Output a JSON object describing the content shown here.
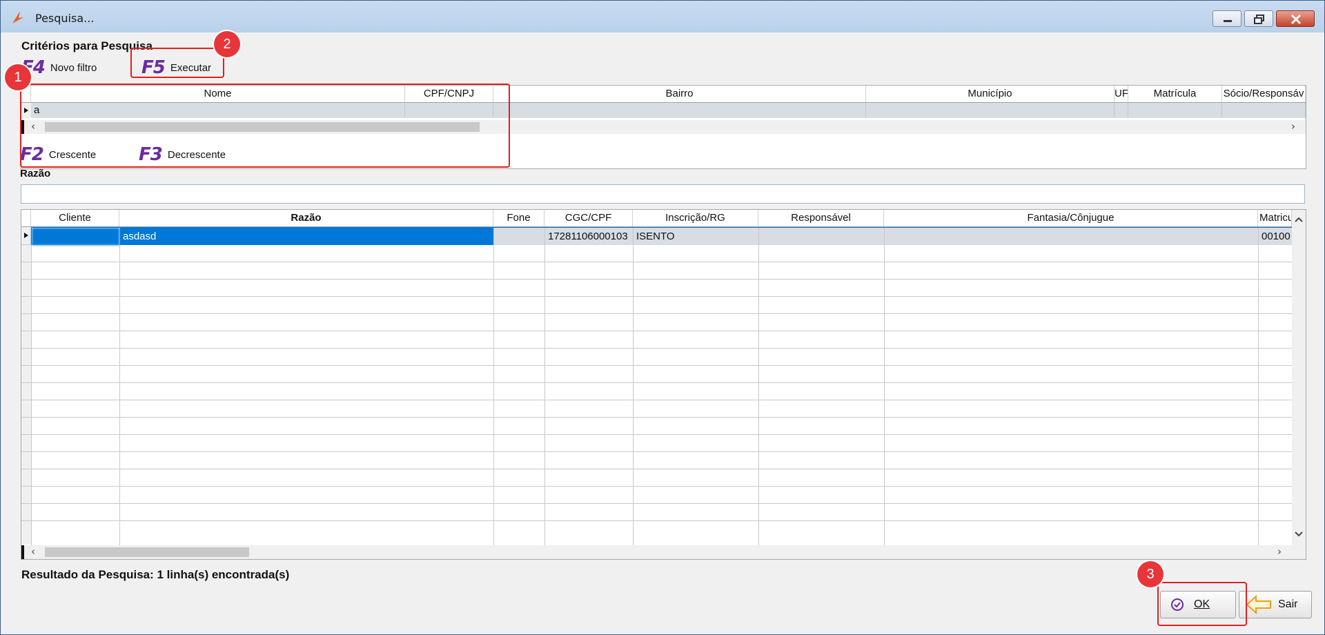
{
  "window": {
    "title": "Pesquisa..."
  },
  "criteria": {
    "title": "Critérios para Pesquisa",
    "new_filter": {
      "key": "F4",
      "label": "Novo filtro"
    },
    "execute": {
      "key": "F5",
      "label": "Executar"
    },
    "columns": [
      "Nome",
      "CPF/CNPJ",
      "Bairro",
      "Município",
      "UF",
      "Matrícula",
      "Sócio/Responsáv"
    ],
    "row": [
      "a",
      "",
      "",
      "",
      "",
      "",
      ""
    ]
  },
  "sort": {
    "ascending": {
      "key": "F2",
      "label": "Crescente"
    },
    "descending": {
      "key": "F3",
      "label": "Decrescente"
    }
  },
  "search_field": {
    "label": "Razão",
    "value": ""
  },
  "results": {
    "columns": [
      "Cliente",
      "Razão",
      "Fone",
      "CGC/CPF",
      "Inscrição/RG",
      "Responsável",
      "Fantasia/Cônjugue",
      "Matricu"
    ],
    "rows": [
      {
        "cliente": "",
        "razao": "asdasd",
        "fone": "",
        "cgc": "17281106000103",
        "inscricao": "ISENTO",
        "responsavel": "",
        "fantasia": "",
        "matricula": "00100"
      }
    ]
  },
  "status": "Resultado da Pesquisa: 1 linha(s) encontrada(s)",
  "buttons": {
    "ok": "OK",
    "exit": "Sair"
  },
  "annotations": [
    "1",
    "2",
    "3"
  ],
  "colors": {
    "selection": "#0078d7",
    "fkey": "#6a2c9e",
    "annotation": "#e02020"
  }
}
